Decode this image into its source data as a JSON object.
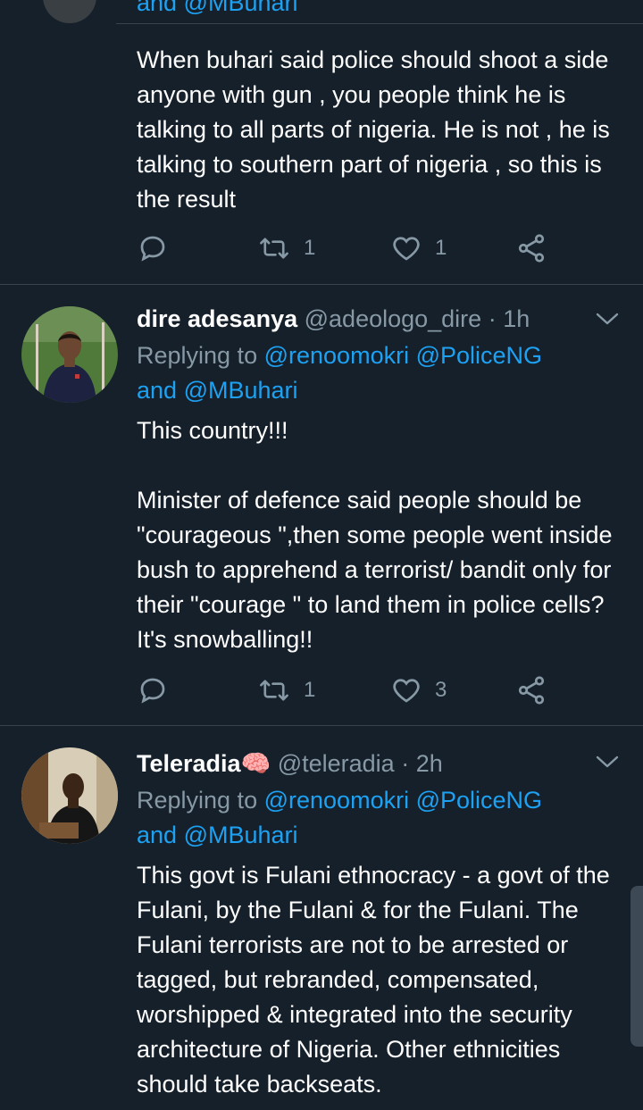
{
  "colors": {
    "background": "#15202b",
    "divider": "#38444d",
    "muted": "#8899a6",
    "link": "#1da1f2",
    "text": "#ffffff"
  },
  "partial_tweet": {
    "cut_off_text": "and @MBuhari",
    "text": "When buhari said police should shoot a side anyone with gun , you people think he is talking to all parts of nigeria.  He is not , he is talking to southern part of nigeria , so this is the result",
    "actions": {
      "reply_icon": "reply-icon",
      "retweet_count": "1",
      "like_count": "1",
      "share_icon": "share-icon"
    }
  },
  "tweets": [
    {
      "name": "dire adesanya",
      "handle": "@adeologo_dire",
      "dot": "·",
      "time": "1h",
      "replying_prefix": "Replying to",
      "mentions": [
        "@renoomokri",
        "@PoliceNG",
        "@MBuhari"
      ],
      "and_word": "and",
      "text": "This country!!!\n\nMinister of defence said people should be \"courageous \",then some people went inside bush to apprehend a terrorist/ bandit only for their \"courage \" to land them in police cells? It's snowballing!!",
      "retweet_count": "1",
      "like_count": "3"
    },
    {
      "name": "Teleradia",
      "name_emoji": "🧠",
      "handle": "@teleradia",
      "dot": "·",
      "time": "2h",
      "replying_prefix": "Replying to",
      "mentions": [
        "@renoomokri",
        "@PoliceNG",
        "@MBuhari"
      ],
      "and_word": "and",
      "text": "This govt is Fulani ethnocracy - a govt of the Fulani, by the Fulani & for the Fulani. The Fulani terrorists are not to be arrested or tagged, but rebranded, compensated, worshipped & integrated into the security architecture of Nigeria. Other ethnicities should take backseats."
    }
  ]
}
